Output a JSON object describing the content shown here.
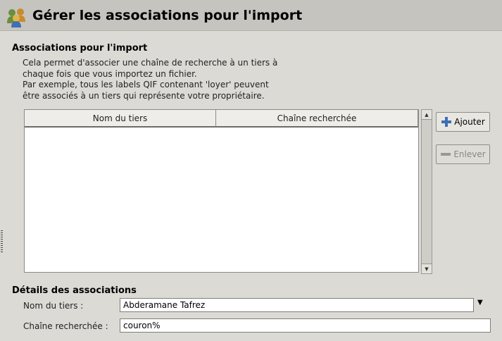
{
  "header": {
    "icon": "people-icon",
    "title": "Gérer les associations pour l'import"
  },
  "associations": {
    "title": "Associations pour l'import",
    "description": [
      "Cela permet d'associer une chaîne de recherche à un tiers à",
      "chaque fois que vous importez un fichier.",
      "Par exemple, tous les labels QIF contenant 'loyer' peuvent",
      "être associés à un tiers qui représente votre propriétaire."
    ],
    "columns": [
      "Nom du tiers",
      "Chaîne recherchée"
    ],
    "rows": []
  },
  "buttons": {
    "add_label": "Ajouter",
    "remove_label": "Enlever"
  },
  "details": {
    "title": "Détails des associations",
    "payee_label": "Nom du tiers :",
    "payee_value": "Abderamane Tafrez",
    "search_label": "Chaîne recherchée :",
    "search_value": "couron%"
  }
}
